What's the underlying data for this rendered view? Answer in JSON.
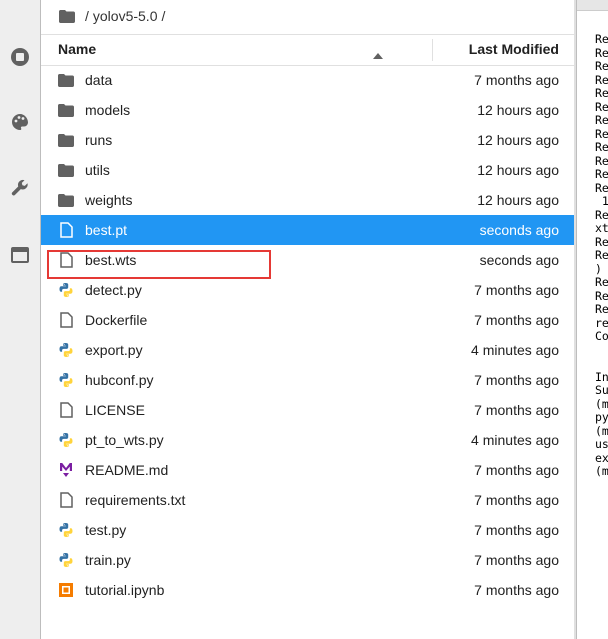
{
  "breadcrumb": {
    "sep1": "/",
    "folder": "yolov5-5.0",
    "sep2": "/"
  },
  "header": {
    "name_label": "Name",
    "modified_label": "Last Modified"
  },
  "files": [
    {
      "name": "data",
      "modified": "7 months ago",
      "icon": "folder-icon"
    },
    {
      "name": "models",
      "modified": "12 hours ago",
      "icon": "folder-icon"
    },
    {
      "name": "runs",
      "modified": "12 hours ago",
      "icon": "folder-icon"
    },
    {
      "name": "utils",
      "modified": "12 hours ago",
      "icon": "folder-icon"
    },
    {
      "name": "weights",
      "modified": "12 hours ago",
      "icon": "folder-icon"
    },
    {
      "name": "best.pt",
      "modified": "seconds ago",
      "icon": "file-icon",
      "selected": true
    },
    {
      "name": "best.wts",
      "modified": "seconds ago",
      "icon": "file-icon",
      "highlighted": true
    },
    {
      "name": "detect.py",
      "modified": "7 months ago",
      "icon": "python-icon"
    },
    {
      "name": "Dockerfile",
      "modified": "7 months ago",
      "icon": "file-icon"
    },
    {
      "name": "export.py",
      "modified": "4 minutes ago",
      "icon": "python-icon"
    },
    {
      "name": "hubconf.py",
      "modified": "7 months ago",
      "icon": "python-icon"
    },
    {
      "name": "LICENSE",
      "modified": "7 months ago",
      "icon": "file-icon"
    },
    {
      "name": "pt_to_wts.py",
      "modified": "4 minutes ago",
      "icon": "python-icon"
    },
    {
      "name": "README.md",
      "modified": "7 months ago",
      "icon": "markdown-icon"
    },
    {
      "name": "requirements.txt",
      "modified": "7 months ago",
      "icon": "file-icon"
    },
    {
      "name": "test.py",
      "modified": "7 months ago",
      "icon": "python-icon"
    },
    {
      "name": "train.py",
      "modified": "7 months ago",
      "icon": "python-icon"
    },
    {
      "name": "tutorial.ipynb",
      "modified": "7 months ago",
      "icon": "notebook-icon"
    }
  ],
  "terminal_lines": [
    "Re",
    "Re",
    "Re",
    "Re",
    "Re",
    "Re",
    "Re",
    "Re",
    "Re",
    "Re",
    "Re",
    "Re",
    " 1",
    "Re",
    "xt",
    "Re",
    "Re",
    ")",
    "Re",
    "Re",
    "Re",
    "re",
    "Co",
    "",
    "",
    "In",
    "Su",
    "(m",
    "py",
    "(m",
    "us",
    "ex",
    "(m"
  ],
  "colors": {
    "accent": "#2196f3",
    "highlight_border": "#e53935",
    "python_blue": "#3572a5",
    "python_yellow": "#ffd43b",
    "markdown": "#7b1fa2",
    "notebook": "#f57c00"
  }
}
